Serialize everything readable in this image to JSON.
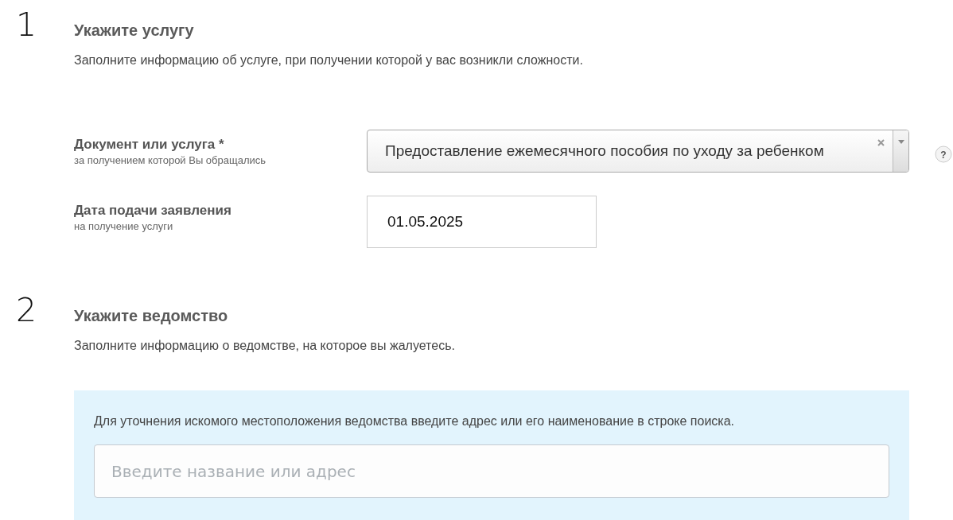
{
  "sections": [
    {
      "number": "1",
      "title": "Укажите услугу",
      "description": "Заполните информацию об услуге, при получении которой у вас возникли сложности.",
      "fields": [
        {
          "kind": "select",
          "label": "Документ или услуга *",
          "hint": "за получением которой Вы обращались",
          "value": "Предоставление ежемесячного пособия по уходу за ребенком",
          "help": "?"
        },
        {
          "kind": "text",
          "label": "Дата подачи заявления",
          "hint": "на получение услуги",
          "value": "01.05.2025"
        }
      ]
    },
    {
      "number": "2",
      "title": "Укажите ведомство",
      "description": "Заполните информацию о ведомстве, на которое вы жалуетесь.",
      "search": {
        "instruction": "Для уточнения искомого местоположения ведомства введите адрес или его наименование в строке поиска.",
        "placeholder": "Введите название или адрес"
      }
    }
  ]
}
